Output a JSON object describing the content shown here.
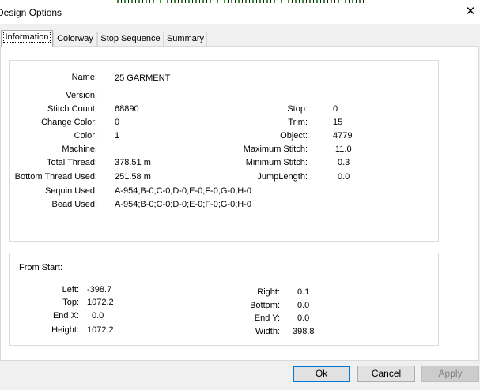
{
  "window": {
    "title": "Design Options",
    "close_glyph": "✕"
  },
  "tabs": [
    "Information",
    "Colorway",
    "Stop Sequence",
    "Summary"
  ],
  "info": {
    "name_label": "Name:",
    "name": "25 GARMENT",
    "version_label": "Version:",
    "version": "",
    "stitch_count_label": "Stitch Count:",
    "stitch_count": "68890",
    "change_color_label": "Change Color:",
    "change_color": "0",
    "color_label": "Color:",
    "color": "1",
    "machine_label": "Machine:",
    "machine": "",
    "total_thread_label": "Total Thread:",
    "total_thread": "378.51 m",
    "bottom_thread_label": "Bottom Thread Used:",
    "bottom_thread": "251.58 m",
    "sequin_label": "Sequin Used:",
    "sequin": "A-954;B-0;C-0;D-0;E-0;F-0;G-0;H-0",
    "bead_label": "Bead Used:",
    "bead": "A-954;B-0;C-0;D-0;E-0;F-0;G-0;H-0",
    "stop_label": "Stop:",
    "stop": "0",
    "trim_label": "Trim:",
    "trim": "15",
    "object_label": "Object:",
    "object": "4779",
    "max_stitch_label": "Maximum Stitch:",
    "max_stitch": "11.0",
    "min_stitch_label": "Minimum Stitch:",
    "min_stitch": "0.3",
    "jump_length_label": "JumpLength:",
    "jump_length": "0.0"
  },
  "from_start": {
    "heading": "From Start:",
    "left_label": "Left:",
    "left": "-398.7",
    "top_label": "Top:",
    "top": "1072.2",
    "end_x_label": "End X:",
    "end_x": "0.0",
    "height_label": "Height:",
    "height": "1072.2",
    "right_label": "Right:",
    "right": "0.1",
    "bottom_label": "Bottom:",
    "bottom": "0.0",
    "end_y_label": "End Y:",
    "end_y": "0.0",
    "width_label": "Width:",
    "width": "398.8"
  },
  "buttons": {
    "ok": "Ok",
    "cancel": "Cancel",
    "apply": "Apply"
  }
}
